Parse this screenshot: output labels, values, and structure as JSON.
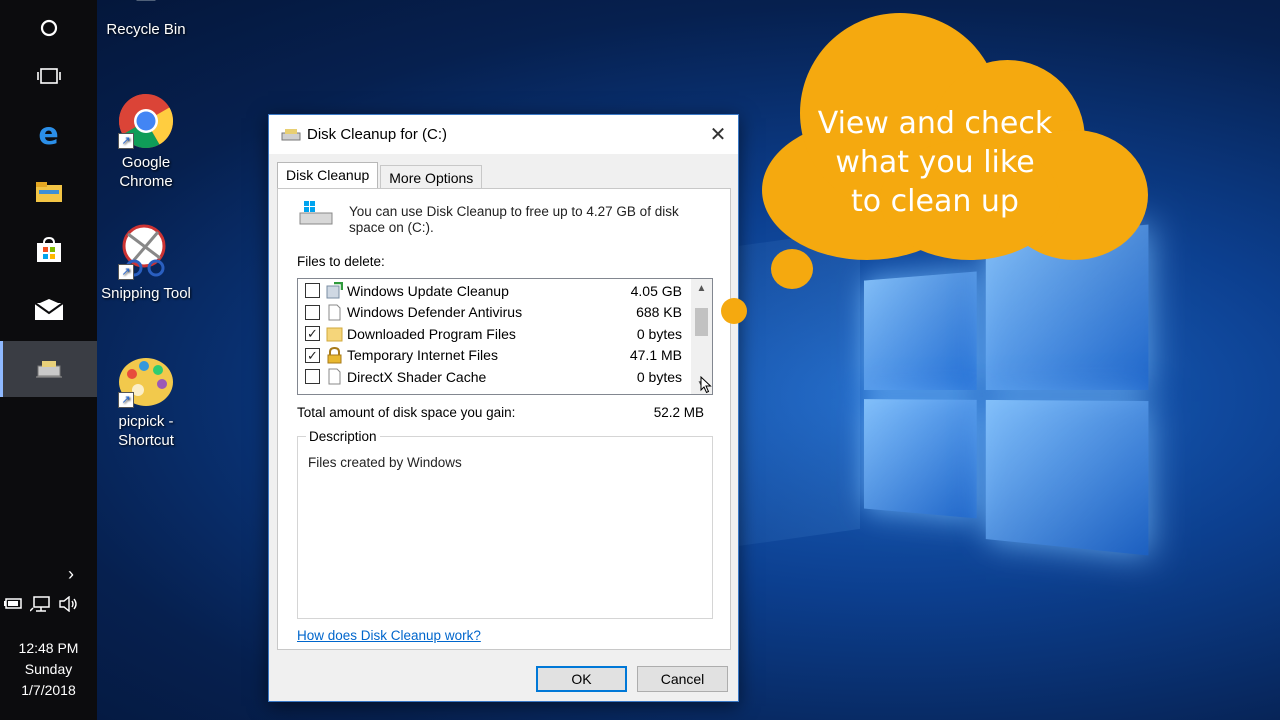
{
  "desktop": {
    "icons": [
      {
        "label": "Recycle Bin",
        "icon": "recycle-bin-icon"
      },
      {
        "label": "Google\nChrome",
        "label_line1": "Google",
        "label_line2": "Chrome",
        "icon": "chrome-icon"
      },
      {
        "label_line1": "Snipping Tool",
        "icon": "snipping-tool-icon"
      },
      {
        "label_line1": "picpick -",
        "label_line2": "Shortcut",
        "icon": "picpick-icon"
      }
    ]
  },
  "taskbar": {
    "buttons": [
      {
        "name": "cortana-icon",
        "glyph": "○"
      },
      {
        "name": "task-view-icon",
        "glyph": "▭"
      },
      {
        "name": "edge-icon",
        "glyph": "e"
      },
      {
        "name": "file-explorer-icon",
        "glyph": "▬"
      },
      {
        "name": "store-icon",
        "glyph": "■"
      },
      {
        "name": "mail-icon",
        "glyph": "✉"
      },
      {
        "name": "disk-cleanup-task-icon",
        "glyph": ""
      }
    ],
    "tray": {
      "chevron": "›",
      "battery": "▭",
      "network": "🖳",
      "volume": "🔊"
    },
    "clock": {
      "time": "12:48 PM",
      "day": "Sunday",
      "date": "1/7/2018"
    }
  },
  "dialog": {
    "title": "Disk Cleanup for  (C:)",
    "close": "✕",
    "tabs": [
      {
        "label": "Disk Cleanup",
        "active": true
      },
      {
        "label": "More Options",
        "active": false
      }
    ],
    "info_text": "You can use Disk Cleanup to free up to 4.27 GB of disk space on  (C:).",
    "files_label": "Files to delete:",
    "files": [
      {
        "name": "Windows Update Cleanup",
        "size": "4.05 GB",
        "checked": false,
        "icon": "windows-update-icon"
      },
      {
        "name": "Windows Defender Antivirus",
        "size": "688 KB",
        "checked": false,
        "icon": "document-icon"
      },
      {
        "name": "Downloaded Program Files",
        "size": "0 bytes",
        "checked": true,
        "icon": "folder-icon"
      },
      {
        "name": "Temporary Internet Files",
        "size": "47.1 MB",
        "checked": true,
        "icon": "lock-icon"
      },
      {
        "name": "DirectX Shader Cache",
        "size": "0 bytes",
        "checked": false,
        "icon": "document-icon"
      }
    ],
    "total_label": "Total amount of disk space you gain:",
    "total_value": "52.2 MB",
    "description_legend": "Description",
    "description_text": "Files created by Windows",
    "help_link": "How does Disk Cleanup work?",
    "ok_label": "OK",
    "cancel_label": "Cancel"
  },
  "callout": {
    "line1": "View and check",
    "line2": "what you like",
    "line3": "to clean up",
    "color": "#f5a90f"
  }
}
